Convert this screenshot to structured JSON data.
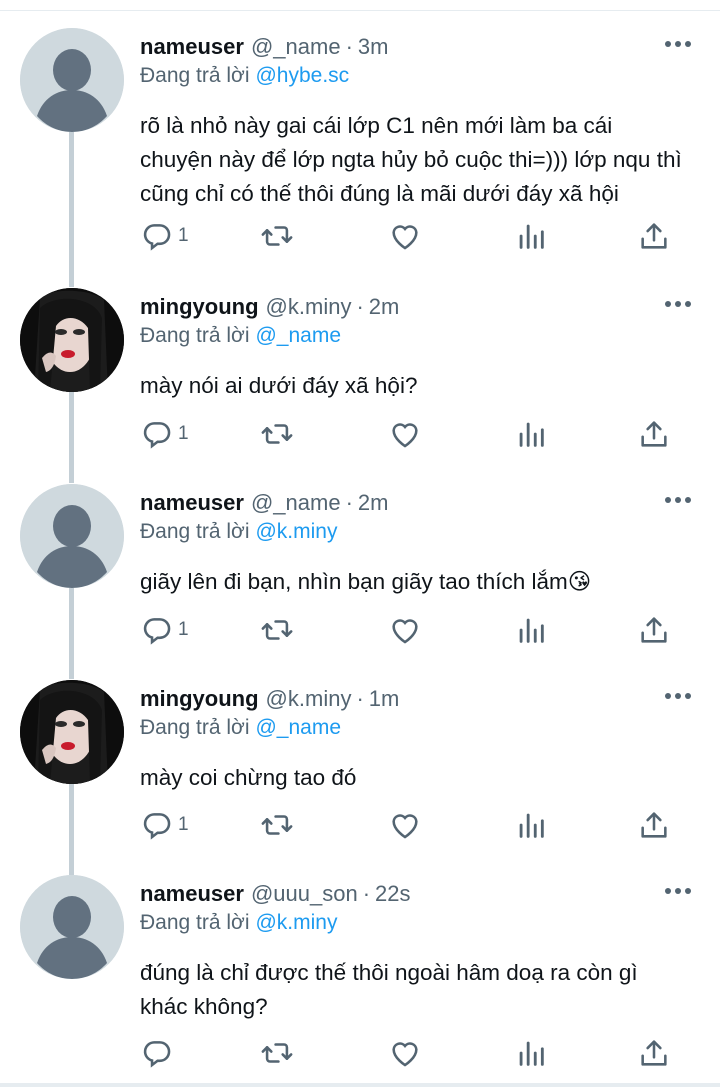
{
  "tweets": [
    {
      "name": "nameuser",
      "handle": "@_name",
      "sep": "·",
      "time": "3m",
      "replying_label": "Đang trả lời",
      "replying_to": "@hybe.sc",
      "text": "rõ là nhỏ này gai cái lớp C1 nên mới làm ba cái chuyện này để lớp ngta hủy bỏ cuộc thi=))) lớp nqu thì cũng chỉ có thế thôi đúng là mãi dưới đáy xã hội",
      "reply_count": "1",
      "avatar": "default-avatar"
    },
    {
      "name": "mingyoung",
      "handle": "@k.miny",
      "sep": "·",
      "time": "2m",
      "replying_label": "Đang trả lời",
      "replying_to": "@_name",
      "text": "mày nói ai dưới đáy xã hội?",
      "reply_count": "1",
      "avatar": "photo-avatar"
    },
    {
      "name": "nameuser",
      "handle": "@_name",
      "sep": "·",
      "time": "2m",
      "replying_label": "Đang trả lời",
      "replying_to": "@k.miny",
      "text": "giãy lên đi bạn, nhìn bạn giãy tao thích lắm😘",
      "reply_count": "1",
      "avatar": "default-avatar"
    },
    {
      "name": "mingyoung",
      "handle": "@k.miny",
      "sep": "·",
      "time": "1m",
      "replying_label": "Đang trả lời",
      "replying_to": "@_name",
      "text": "mày coi chừng tao đó",
      "reply_count": "1",
      "avatar": "photo-avatar"
    },
    {
      "name": "nameuser",
      "handle": "@uuu_son",
      "sep": "·",
      "time": "22s",
      "replying_label": "Đang trả lời",
      "replying_to": "@k.miny",
      "text": "đúng là chỉ được thế thôi ngoài hâm doạ ra còn gì khác không?",
      "reply_count": "",
      "avatar": "default-avatar"
    }
  ],
  "icons": {
    "more": "more-dots-icon",
    "reply": "reply-icon",
    "retweet": "retweet-icon",
    "like": "heart-icon",
    "views": "views-icon",
    "share": "share-icon"
  },
  "colors": {
    "text": "#0f1419",
    "secondary": "#536471",
    "link": "#1d9bf0",
    "thread_line": "#c4cfd6",
    "default_avatar": "#cfd9de"
  }
}
